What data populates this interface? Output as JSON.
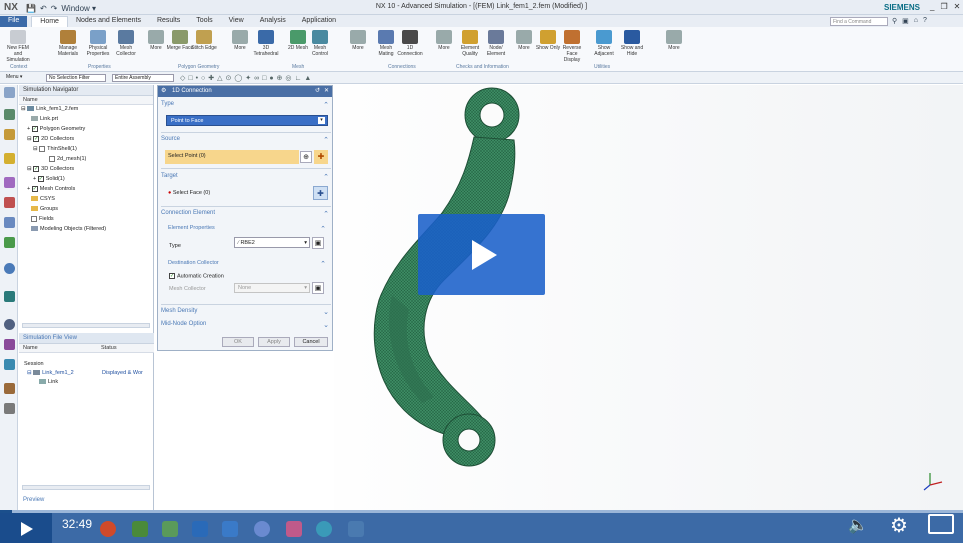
{
  "app": {
    "logo": "NX",
    "window_title": "NX 10 - Advanced Simulation - [(FEM) Link_fem1_2.fem (Modified) ]",
    "brand": "SIEMENS",
    "window_menu": "Window",
    "find_command_placeholder": "Find a Command"
  },
  "tabs": [
    "File",
    "Home",
    "Nodes and Elements",
    "Results",
    "Tools",
    "View",
    "Analysis",
    "Application"
  ],
  "active_tab": "Home",
  "ribbon": {
    "buttons": [
      {
        "label": "New FEM and Simulation",
        "icon": "new-fem-icon"
      },
      {
        "label": "Manage Materials",
        "icon": "materials-icon"
      },
      {
        "label": "Physical Properties",
        "icon": "physical-properties-icon"
      },
      {
        "label": "Mesh Collector",
        "icon": "mesh-collector-icon"
      },
      {
        "label": "More",
        "icon": "more-icon"
      },
      {
        "label": "Merge Face",
        "icon": "merge-face-icon"
      },
      {
        "label": "Stitch Edge",
        "icon": "stitch-edge-icon"
      },
      {
        "label": "More",
        "icon": "more-icon"
      },
      {
        "label": "3D Tetrahedral",
        "icon": "tetrahedral-icon"
      },
      {
        "label": "2D Mesh",
        "icon": "mesh2d-icon"
      },
      {
        "label": "Mesh Control",
        "icon": "mesh-control-icon"
      },
      {
        "label": "More",
        "icon": "more-icon"
      },
      {
        "label": "Mesh Mating",
        "icon": "mesh-mating-icon"
      },
      {
        "label": "1D Connection",
        "icon": "connection-1d-icon"
      },
      {
        "label": "More",
        "icon": "more-icon"
      },
      {
        "label": "Element Quality",
        "icon": "element-quality-icon"
      },
      {
        "label": "Node/ Element",
        "icon": "node-element-icon"
      },
      {
        "label": "More",
        "icon": "more-icon"
      },
      {
        "label": "Show Only",
        "icon": "show-only-icon"
      },
      {
        "label": "Reverse Face Display",
        "icon": "reverse-face-icon"
      },
      {
        "label": "Show Adjacent",
        "icon": "show-adjacent-icon"
      },
      {
        "label": "Show and Hide",
        "icon": "show-hide-icon"
      },
      {
        "label": "More",
        "icon": "more-icon"
      }
    ],
    "groups": [
      "Context",
      "Properties",
      "Polygon Geometry",
      "Mesh",
      "Connections",
      "Checks and Information",
      "Utilities"
    ]
  },
  "toolbar2": {
    "menu": "Menu",
    "selection_filter": "No Selection Filter",
    "assembly": "Entire Assembly"
  },
  "navigator": {
    "title": "Simulation Navigator",
    "col_name": "Name",
    "items": [
      "Link_fem1_2.fem",
      "Link.prt",
      "Polygon Geometry",
      "2D Collectors",
      "ThinShell(1)",
      "2d_mesh(1)",
      "3D Collectors",
      "Solid(1)",
      "Mesh Controls",
      "CSYS",
      "Groups",
      "Fields",
      "Modeling Objects (Filtered)"
    ]
  },
  "file_view": {
    "title": "Simulation File View",
    "col_name": "Name",
    "col_status": "Status",
    "rows": [
      {
        "name": "Session",
        "status": ""
      },
      {
        "name": "Link_fem1_2",
        "status": "Displayed & Wor"
      },
      {
        "name": "Link",
        "status": ""
      }
    ],
    "preview": "Preview"
  },
  "dialog": {
    "title": "1D Connection",
    "type_section": "Type",
    "type_value": "Point to Face",
    "source_section": "Source",
    "source_select": "Select Point (0)",
    "target_section": "Target",
    "target_select": "Select Face (0)",
    "conn_element_section": "Connection Element",
    "element_properties": "Element Properties",
    "type_label": "Type",
    "element_type": "RBE2",
    "dest_collector": "Destination Collector",
    "auto_creation": "Automatic Creation",
    "mesh_collector_label": "Mesh Collector",
    "mesh_collector_value": "None",
    "mesh_density": "Mesh Density",
    "mid_node": "Mid-Node Option",
    "ok": "OK",
    "apply": "Apply",
    "cancel": "Cancel"
  },
  "player": {
    "time": "32:49",
    "progress": 0.012
  },
  "colors": {
    "accent": "#3c6aa6",
    "play_overlay": "#1a60ca",
    "model_green": "#2f7a55",
    "highlight": "#f7d68c"
  }
}
